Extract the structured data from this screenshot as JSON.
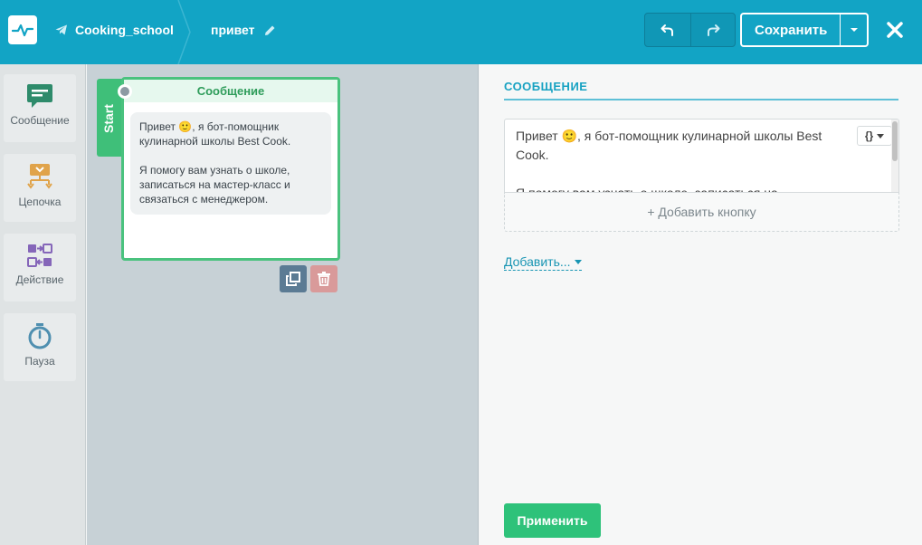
{
  "header": {
    "bot_name": "Cooking_school",
    "flow_name": "привет",
    "save_label": "Сохранить"
  },
  "palette": {
    "items": [
      {
        "label": "Сообщение",
        "icon": "message-icon"
      },
      {
        "label": "Цепочка",
        "icon": "chain-icon"
      },
      {
        "label": "Действие",
        "icon": "action-icon"
      },
      {
        "label": "Пауза",
        "icon": "timer-icon"
      }
    ]
  },
  "canvas": {
    "start_label": "Start",
    "node": {
      "title": "Сообщение",
      "line1": "Привет 🙂, я бот-помощник кулинарной школы Best Cook.",
      "line2": "Я помогу вам узнать о школе, записаться на мастер-класс и связаться с менеджером."
    }
  },
  "panel": {
    "title": "СООБЩЕНИЕ",
    "message_line1": "Привет 🙂, я бот-помощник кулинарной школы Best Cook.",
    "message_line2": "Я помогу вам узнать о школе, записаться на",
    "var_label": "{}",
    "add_button_label": "+ Добавить кнопку",
    "add_more_label": "Добавить...",
    "apply_label": "Применить"
  },
  "colors": {
    "header": "#12a4c5",
    "accent_green": "#2ec27a",
    "node_border": "#4ac27e",
    "copy_button": "#5b7b94",
    "delete_button": "#d99a9a"
  }
}
